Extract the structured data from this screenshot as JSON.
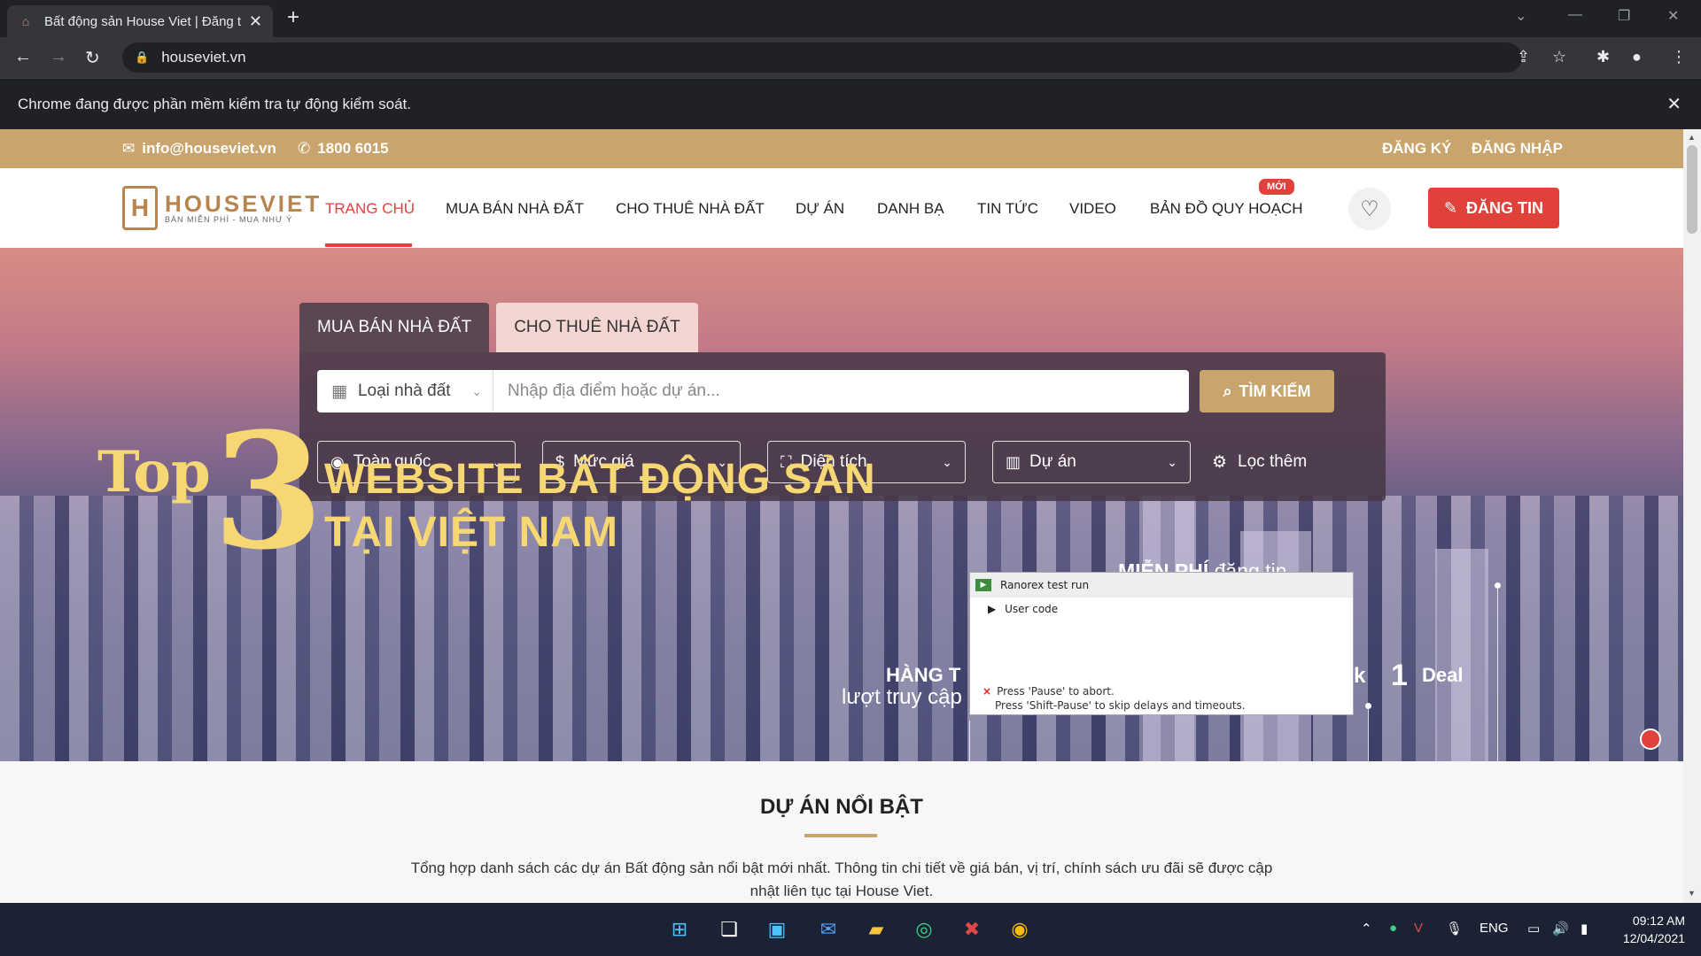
{
  "browser": {
    "tab_title": "Bất động sản House Viet | Đăng t",
    "url": "houseviet.vn",
    "infobar_text": "Chrome đang được phần mềm kiểm tra tự động kiểm soát."
  },
  "topbar": {
    "email": "info@houseviet.vn",
    "phone": "1800 6015",
    "register": "ĐĂNG KÝ",
    "login": "ĐĂNG NHẬP"
  },
  "header": {
    "logo_text": "HOUSEVIET",
    "logo_tagline": "BÁN MIỄN PHÍ - MUA NHƯ Ý",
    "menu": [
      "TRANG CHỦ",
      "MUA BÁN NHÀ ĐẤT",
      "CHO THUÊ NHÀ ĐẤT",
      "DỰ ÁN",
      "DANH BẠ",
      "TIN TỨC",
      "VIDEO",
      "BẢN ĐỒ QUY HOẠCH"
    ],
    "new_badge": "MỚI",
    "post_button": "ĐĂNG TIN",
    "accent": "#e0413a",
    "gold": "#c9a46c"
  },
  "search": {
    "tabs": [
      "MUA BÁN NHÀ ĐẤT",
      "CHO THUÊ NHÀ ĐẤT"
    ],
    "type_select": "Loại nhà đất",
    "placeholder": "Nhập địa điểm hoặc dự án...",
    "search_button": "TÌM KIẾM",
    "filters": [
      "Toàn quốc",
      "Mức giá",
      "Diện tích",
      "Dự án"
    ],
    "more_filter": "Lọc thêm"
  },
  "banner": {
    "top": "Top",
    "number": "3",
    "line1": "WEBSITE BẤT ĐỘNG SẢN",
    "line2": "TẠI VIỆT NAM",
    "mienphi_bold": "MIỄN PHÍ",
    "mienphi_rest": " đăng tin",
    "hang": "HÀNG T",
    "luot": "lượt truy cập",
    "k": "k",
    "one": "1",
    "deal": "Deal"
  },
  "featured": {
    "title": "DỰ ÁN NỔI BẬT",
    "desc": "Tổng hợp danh sách các dự án Bất động sản nổi bật mới nhất. Thông tin chi tiết về giá bán, vị trí, chính sách ưu đãi sẽ được cập nhật liên tục tại House Viet."
  },
  "ranorex": {
    "title": "Ranorex test run",
    "node": "User code",
    "msg1": "Press 'Pause' to abort.",
    "msg2": "Press 'Shift-Pause' to skip delays and timeouts."
  },
  "taskbar": {
    "lang": "ENG",
    "time": "09:12 AM",
    "date": "12/04/2021"
  }
}
